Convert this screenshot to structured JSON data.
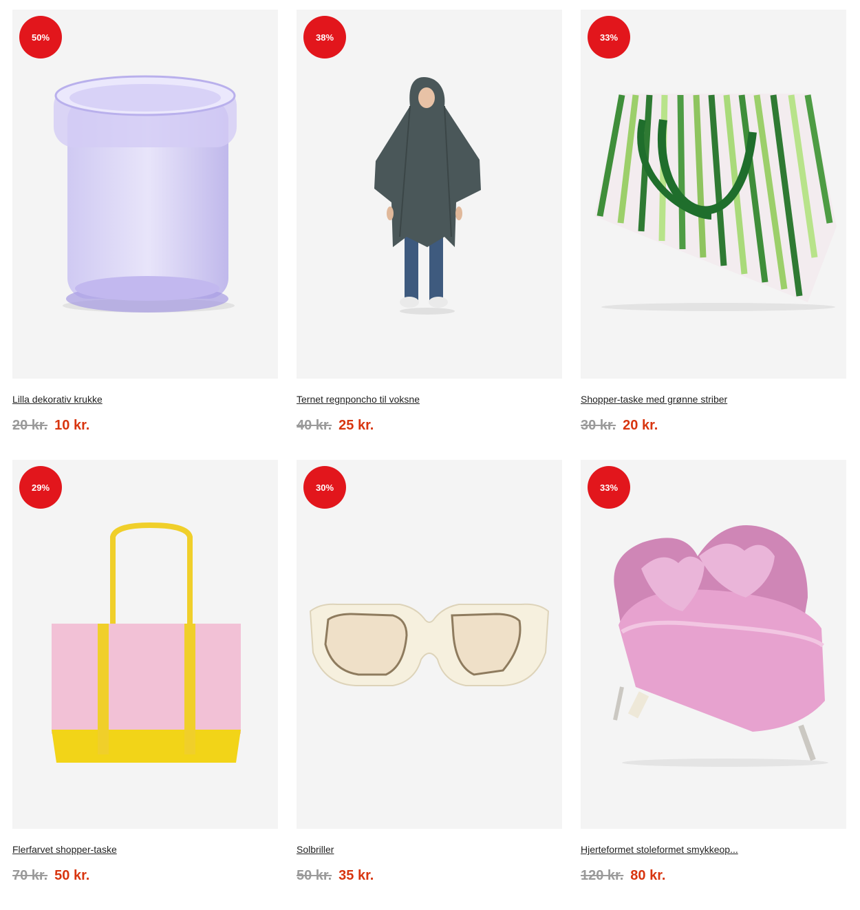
{
  "products": [
    {
      "badge": "50%",
      "title": "Lilla dekorativ krukke",
      "old_price": "20 kr.",
      "new_price": "10 kr.",
      "icon": "purple-jar"
    },
    {
      "badge": "38%",
      "title": "Ternet regnponcho til voksne",
      "old_price": "40 kr.",
      "new_price": "25 kr.",
      "icon": "rain-poncho"
    },
    {
      "badge": "33%",
      "title": "Shopper-taske med grønne striber",
      "old_price": "30 kr.",
      "new_price": "20 kr.",
      "icon": "striped-bag"
    },
    {
      "badge": "29%",
      "title": "Flerfarvet shopper-taske",
      "old_price": "70 kr.",
      "new_price": "50 kr.",
      "icon": "tote-bag"
    },
    {
      "badge": "30%",
      "title": "Solbriller",
      "old_price": "50 kr.",
      "new_price": "35 kr.",
      "icon": "sunglasses"
    },
    {
      "badge": "33%",
      "title": "Hjerteformet stoleformet smykkeop...",
      "old_price": "120 kr.",
      "new_price": "80 kr.",
      "icon": "heart-chair-jewelry-box"
    }
  ],
  "colors": {
    "badge": "#e2161c",
    "sale_price": "#d8350f",
    "old_price": "#9a9a9a",
    "card_bg": "#f4f4f4"
  }
}
